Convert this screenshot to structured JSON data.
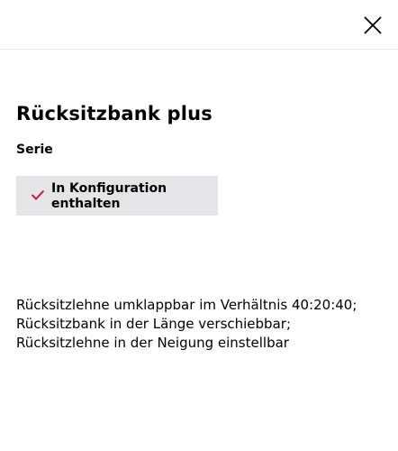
{
  "header": {
    "close_icon": "close-icon"
  },
  "main": {
    "title": "Rücksitzbank plus",
    "subtitle": "Serie",
    "badge": {
      "icon": "checkmark-icon",
      "icon_color": "#c4183c",
      "background": "#e5e5e8",
      "label": "In Konfiguration enthalten"
    },
    "description": "Rücksitzlehne umklappbar im Verhältnis 40:20:40; Rücksitzbank in der Länge verschiebbar; Rücksitzlehne in der Neigung einstellbar"
  }
}
